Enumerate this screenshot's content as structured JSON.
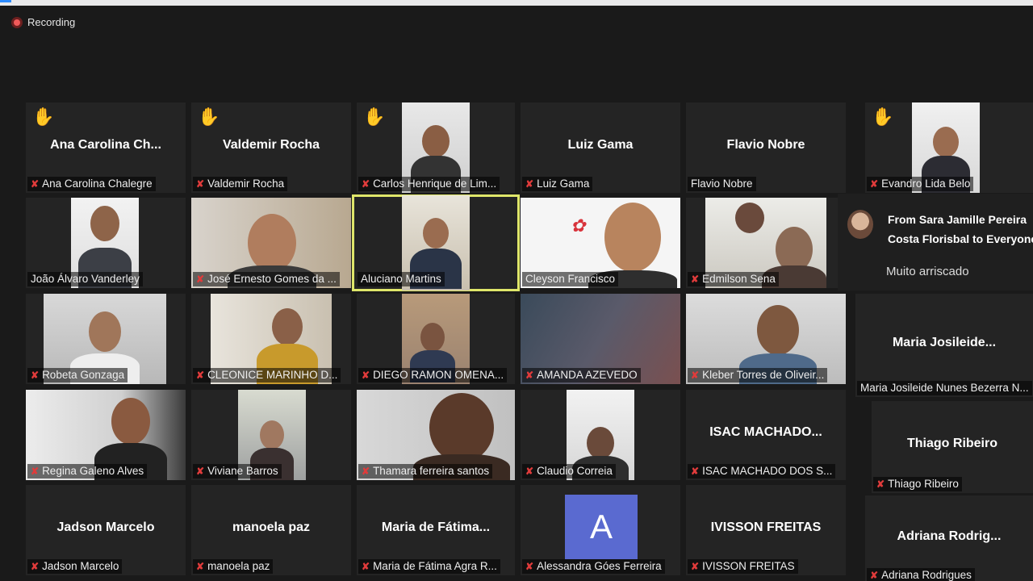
{
  "recording": {
    "label": "Recording"
  },
  "tiles": [
    {
      "display": "Ana Carolina Ch...",
      "label": "Ana Carolina Chalegre"
    },
    {
      "display": "Valdemir Rocha",
      "label": "Valdemir Rocha"
    },
    {
      "label": "Carlos Henrique de Lim..."
    },
    {
      "display": "Luiz Gama",
      "label": "Luiz Gama"
    },
    {
      "display": "Flavio Nobre",
      "label": "Flavio Nobre"
    },
    {
      "label": "Evandro Lida Belo"
    },
    {
      "label": "João Álvaro Vanderley"
    },
    {
      "label": "José Ernesto Gomes da ..."
    },
    {
      "label": "Aluciano Martins"
    },
    {
      "label": "Cleyson Francisco"
    },
    {
      "label": "Edmilson Sena"
    },
    {
      "label": "Robeta Gonzaga"
    },
    {
      "label": "CLEONICE MARINHO D..."
    },
    {
      "label": "DIEGO RAMON OMENA..."
    },
    {
      "label": "AMANDA AZEVEDO"
    },
    {
      "label": "Kleber Torres de Oliveir..."
    },
    {
      "display": "Maria  Josileide...",
      "label": "Maria Josileide Nunes Bezerra N..."
    },
    {
      "label": "Regina Galeno Alves"
    },
    {
      "label": "Viviane Barros"
    },
    {
      "label": "Thamara ferreira santos"
    },
    {
      "label": "Claudio Correia"
    },
    {
      "display": "ISAC  MACHADO...",
      "label": "ISAC MACHADO DOS S..."
    },
    {
      "display": "Thiago Ribeiro",
      "label": "Thiago Ribeiro"
    },
    {
      "display": "Jadson Marcelo",
      "label": "Jadson Marcelo"
    },
    {
      "display": "manoela paz",
      "label": "manoela paz"
    },
    {
      "display": "Maria  de  Fátima...",
      "label": "Maria de Fátima Agra R..."
    },
    {
      "avatar_letter": "A",
      "label": "Alessandra Góes Ferreira"
    },
    {
      "display": "IVISSON FREITAS",
      "label": "IVISSON FREITAS"
    },
    {
      "display": "Adriana  Rodrig...",
      "label": "Adriana Rodrigues"
    }
  ],
  "chat": {
    "from_line1": "From Sara Jamille Pereira",
    "from_line2": "Costa Florisbal to Everyone",
    "message": "Muito arriscado"
  },
  "colors": {
    "active_border": "#dfe66a",
    "muted_mic": "#e03b3b",
    "avatar_bg": "#5a6ad0"
  }
}
